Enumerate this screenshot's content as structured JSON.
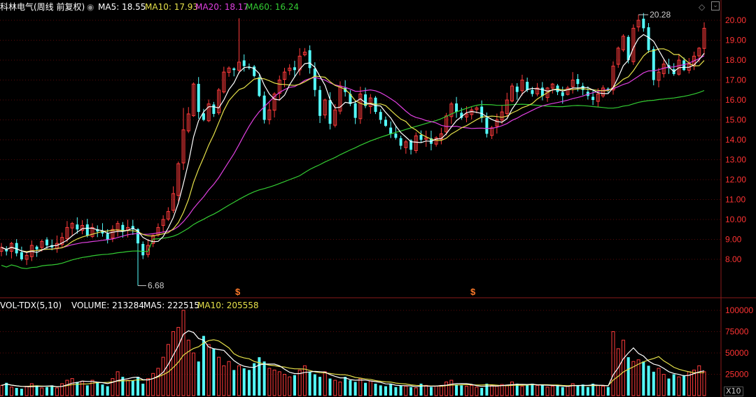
{
  "header": {
    "stock_title": "科林电气(周线 前复权)",
    "ma5_label": "MA5: 18.55",
    "ma10_label": "MA10: 17.93",
    "ma20_label": "MA20: 18.17",
    "ma60_label": "MA60: 16.24",
    "max_price_label": "20.28",
    "min_price_label": "6.68"
  },
  "volume_header": {
    "indicator_label": "VOL-TDX(5,10)",
    "volume_label": "VOLUME: 213284",
    "ma5_label": "MA5: 222515",
    "ma10_label": "MA10: 205558",
    "unit_label": "X10"
  },
  "markers": [
    "$",
    "$"
  ],
  "colors": {
    "up": "#ff3b3b",
    "down": "#54ffff",
    "ma5": "#ffffff",
    "ma10": "#e6e14a",
    "ma20": "#e040e0",
    "ma60": "#33cc33",
    "grid": "#5a0a0a",
    "axis_text": "#ff3333"
  },
  "chart_data": [
    {
      "type": "candlestick",
      "title": "科林电气(周线 前复权)",
      "ylim": [
        6.68,
        20.28
      ],
      "y_ticks": [
        "20.00",
        "19.00",
        "18.00",
        "17.00",
        "16.00",
        "15.00",
        "14.00",
        "13.00",
        "12.00",
        "11.00",
        "10.00",
        "9.00",
        "8.00"
      ],
      "summary": {
        "high": 20.28,
        "low": 6.68,
        "MA5": 18.55,
        "MA10": 17.93,
        "MA20": 18.17,
        "MA60": 16.24
      },
      "close": [
        8.6,
        8.4,
        8.8,
        8.3,
        8.0,
        8.2,
        8.7,
        8.5,
        8.9,
        8.7,
        8.6,
        8.8,
        9.1,
        9.6,
        9.8,
        9.5,
        9.7,
        9.2,
        9.6,
        9.4,
        9.3,
        9.0,
        9.5,
        9.8,
        9.4,
        9.6,
        9.5,
        8.8,
        8.2,
        8.7,
        9.2,
        9.6,
        10.0,
        10.4,
        11.3,
        12.8,
        14.5,
        15.3,
        16.8,
        15.4,
        15.0,
        15.8,
        15.3,
        16.5,
        17.4,
        17.6,
        17.5,
        17.9,
        17.7,
        17.6,
        17.2,
        16.2,
        15.0,
        15.5,
        16.3,
        17.0,
        17.4,
        17.6,
        17.5,
        18.2,
        18.4,
        17.6,
        16.5,
        15.2,
        16.0,
        14.8,
        15.5,
        16.7,
        16.4,
        15.8,
        15.1,
        16.3,
        15.7,
        16.1,
        15.4,
        15.0,
        14.7,
        14.3,
        14.1,
        13.7,
        13.9,
        13.5,
        14.2,
        14.0,
        14.1,
        13.8,
        14.1,
        14.3,
        15.2,
        15.8,
        15.4,
        15.1,
        15.3,
        15.5,
        15.6,
        15.1,
        14.3,
        14.6,
        15.0,
        15.4,
        16.0,
        16.7,
        16.4,
        17.0,
        16.5,
        16.3,
        16.6,
        16.2,
        16.6,
        16.8,
        16.4,
        16.2,
        16.6,
        17.0,
        16.8,
        16.5,
        16.2,
        16.0,
        16.3,
        16.6,
        16.5,
        17.7,
        18.6,
        19.2,
        18.0,
        19.6,
        20.0,
        19.6,
        18.5,
        17.0,
        17.4,
        17.8,
        17.6,
        17.3,
        18.0,
        17.5,
        17.8,
        18.2,
        18.6,
        19.6
      ],
      "volume": [
        12000,
        15000,
        10000,
        9000,
        8000,
        11000,
        14000,
        12000,
        9000,
        10000,
        12000,
        9000,
        14000,
        18000,
        20000,
        16000,
        17000,
        12000,
        18000,
        16000,
        13000,
        11000,
        20000,
        28000,
        22000,
        18000,
        18000,
        22000,
        14000,
        20000,
        26000,
        32000,
        45000,
        60000,
        75000,
        80000,
        100000,
        65000,
        50000,
        40000,
        70000,
        60000,
        55000,
        45000,
        35000,
        40000,
        30000,
        35000,
        32000,
        30000,
        38000,
        45000,
        40000,
        32000,
        30000,
        28000,
        25000,
        22000,
        24000,
        30000,
        35000,
        28000,
        25000,
        22000,
        28000,
        20000,
        18000,
        16000,
        22000,
        18000,
        16000,
        20000,
        15000,
        17000,
        14000,
        12000,
        11000,
        14000,
        10000,
        12000,
        11000,
        10000,
        9000,
        14000,
        12000,
        10000,
        11000,
        12000,
        16000,
        18000,
        13000,
        12000,
        11000,
        12000,
        10000,
        9000,
        14000,
        12000,
        11000,
        13000,
        12000,
        16000,
        14000,
        11000,
        12000,
        14000,
        12000,
        13000,
        10000,
        11000,
        12000,
        10000,
        11000,
        14000,
        12000,
        13000,
        10000,
        14000,
        12000,
        11000,
        10000,
        75000,
        55000,
        65000,
        45000,
        40000,
        42000,
        40000,
        35000,
        28000,
        32000,
        25000,
        20000,
        25000,
        22000,
        24000,
        28000,
        30000,
        35000,
        28000
      ],
      "volume_ylim": [
        0,
        100000
      ],
      "volume_ticks": [
        "100000",
        "75000",
        "50000",
        "25000"
      ]
    }
  ]
}
